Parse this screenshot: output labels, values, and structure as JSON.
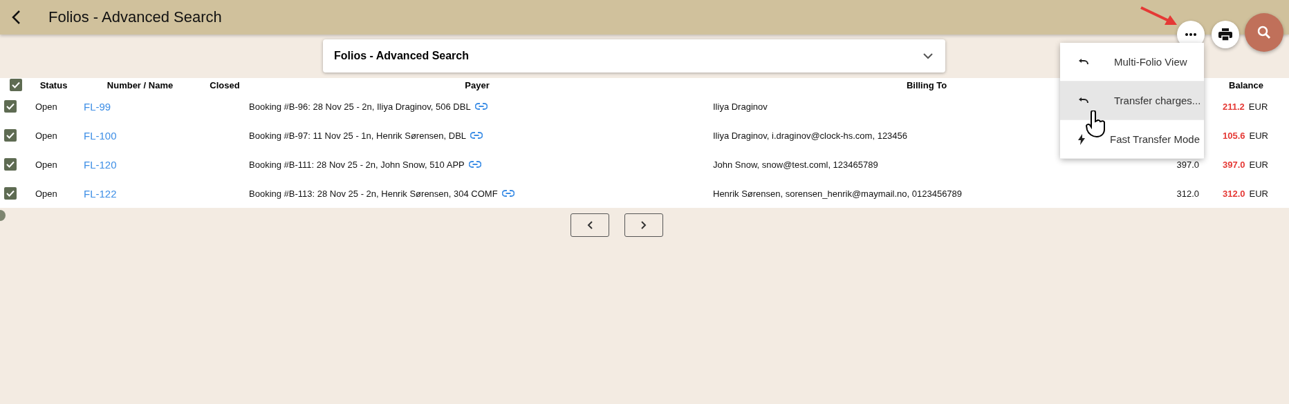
{
  "header": {
    "title": "Folios - Advanced Search"
  },
  "search_panel": {
    "title": "Folios - Advanced Search",
    "expanded": false
  },
  "table": {
    "all_selected": true,
    "columns": [
      "Status",
      "Number / Name",
      "Closed",
      "Payer",
      "Billing To",
      "Balance"
    ],
    "rows": [
      {
        "selected": true,
        "status": "Open",
        "number": "FL-99",
        "payer": "Booking #B-96: 28 Nov 25 - 2n, Iliya Draginov, 506 DBL",
        "billing_to": "Iliya Draginov",
        "balance": "211.2",
        "currency": "EUR"
      },
      {
        "selected": true,
        "status": "Open",
        "number": "FL-100",
        "payer": "Booking #B-97: 11 Nov 25 - 1n, Henrik Sørensen, DBL",
        "billing_to": "Iliya Draginov, i.draginov@clock-hs.com, 123456",
        "balance": "105.6",
        "currency": "EUR"
      },
      {
        "selected": true,
        "status": "Open",
        "number": "FL-120",
        "payer": "Booking #B-111: 28 Nov 25 - 2n, John Snow, 510 APP",
        "billing_to": "John Snow, snow@test.coml, 123465789",
        "amount": "397.0",
        "balance": "397.0",
        "currency": "EUR"
      },
      {
        "selected": true,
        "status": "Open",
        "number": "FL-122",
        "payer": "Booking #B-113: 28 Nov 25 - 2n, Henrik Sørensen, 304 COMF",
        "billing_to": "Henrik Sørensen, sorensen_henrik@maymail.no, 0123456789",
        "amount": "312.0",
        "balance": "312.0",
        "currency": "EUR"
      }
    ]
  },
  "menu": {
    "items": [
      {
        "label": "Multi-Folio View",
        "kind": "undo",
        "selected": false
      },
      {
        "label": "Transfer charges...",
        "kind": "undo",
        "selected": true
      },
      {
        "label": "Fast Transfer Mode",
        "kind": "bolt",
        "selected": false
      }
    ]
  }
}
